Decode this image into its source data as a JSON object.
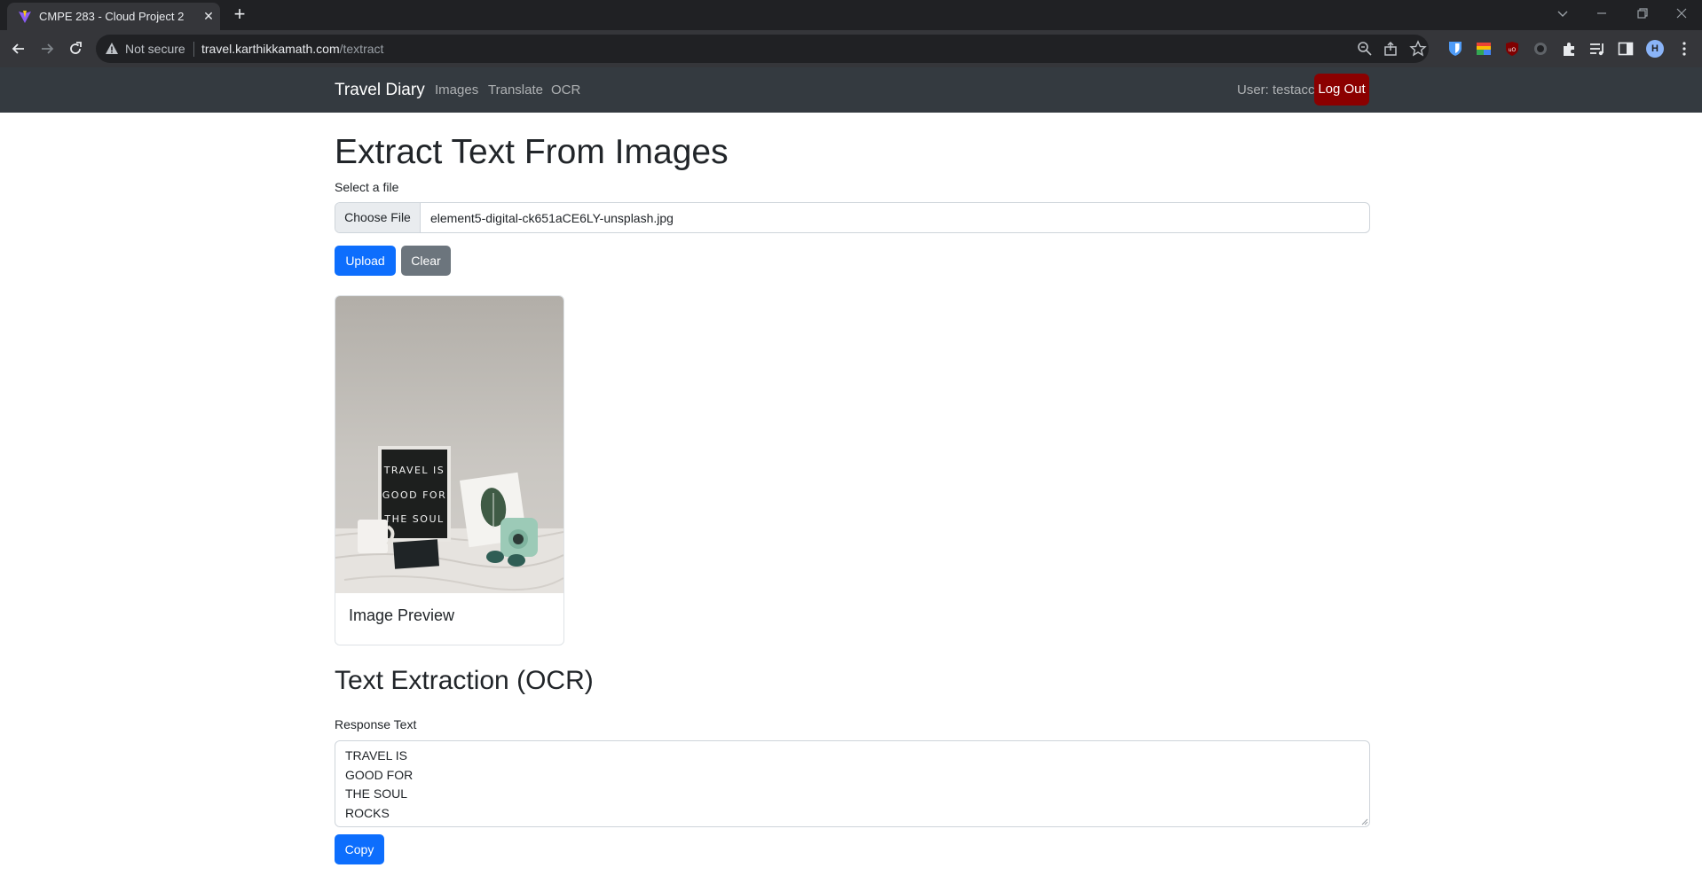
{
  "browser": {
    "tab_title": "CMPE 283 - Cloud Project 2",
    "security_label": "Not secure",
    "url_host": "travel.karthikkamath.com",
    "url_path": "/textract",
    "profile_initial": "H"
  },
  "navbar": {
    "brand": "Travel Diary",
    "links": [
      "Images",
      "Translate",
      "OCR"
    ],
    "user_text": "User: testacc",
    "logout_label": "Log Out"
  },
  "page": {
    "title": "Extract Text From Images",
    "file_label": "Select a file",
    "choose_file_label": "Choose File",
    "file_name": "element5-digital-ck651aCE6LY-unsplash.jpg",
    "upload_label": "Upload",
    "clear_label": "Clear",
    "image_sign_lines": [
      "TRAVEL IS",
      "GOOD FOR",
      "THE SOUL"
    ],
    "card_title": "Image Preview",
    "section_title": "Text Extraction (OCR)",
    "response_label": "Response Text",
    "response_lines": [
      "TRAVEL IS",
      "GOOD FOR",
      "THE SOUL",
      "ROCKS"
    ],
    "copy_label": "Copy"
  },
  "colors": {
    "navbar_bg": "#343a40",
    "primary": "#0d6efd",
    "secondary": "#6c757d",
    "logout_bg": "#8b0000",
    "chrome_bg": "#202124",
    "chrome_toolbar": "#35363a"
  }
}
